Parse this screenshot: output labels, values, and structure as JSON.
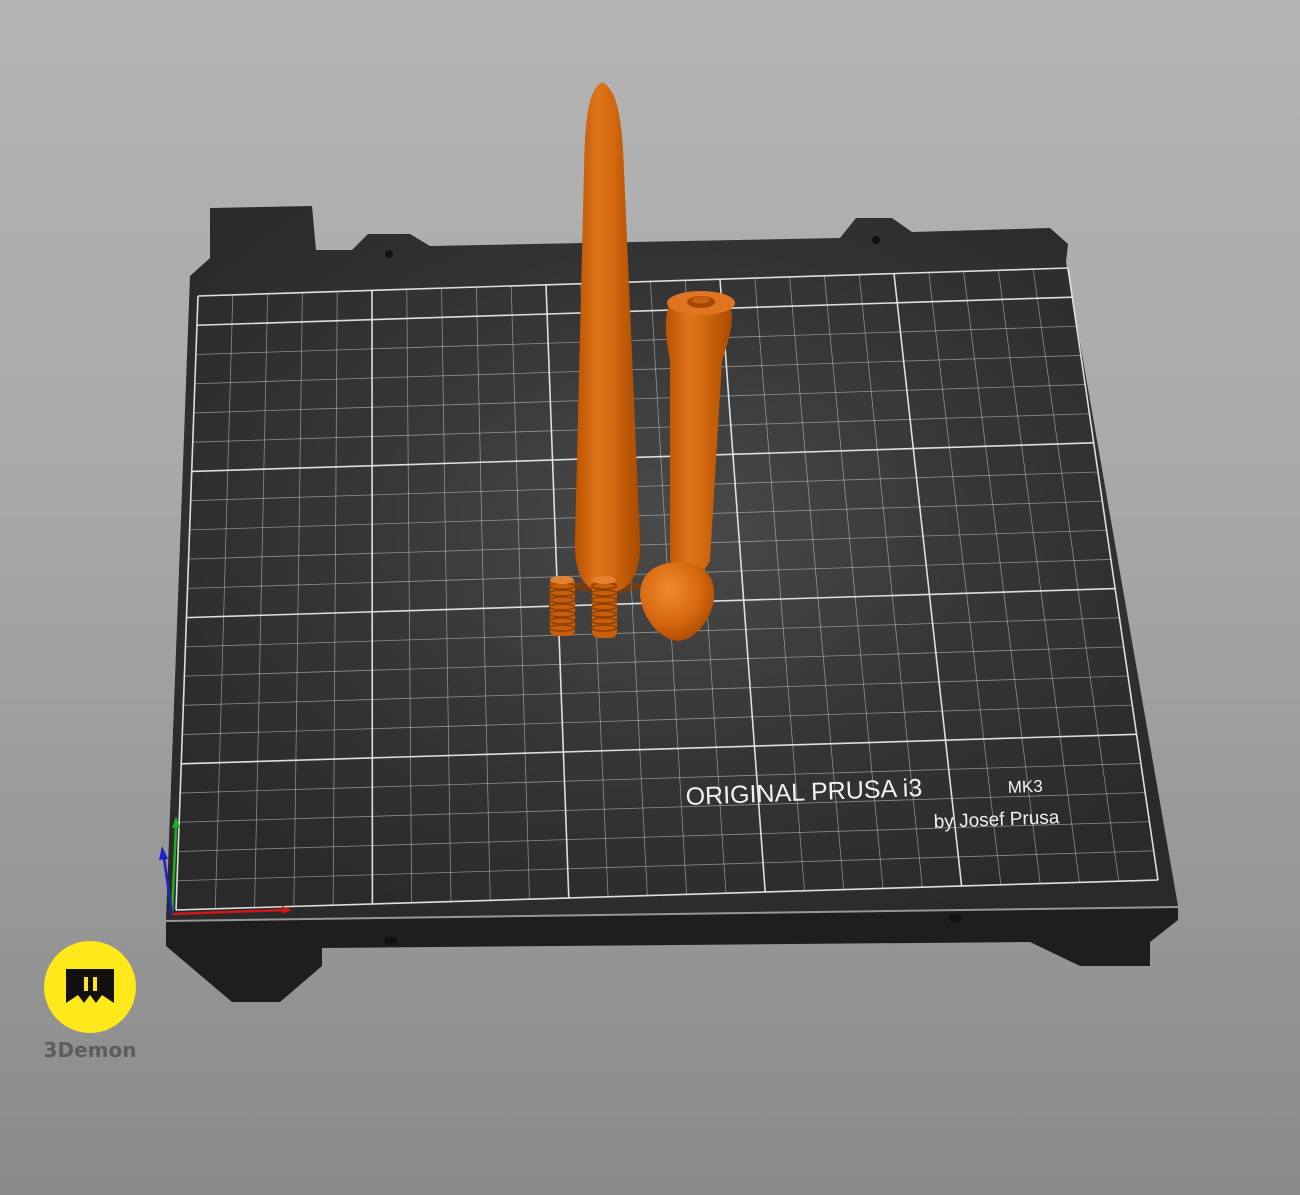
{
  "scene": {
    "background_top": "#b4b4b4",
    "background_bottom": "#8a8a8a",
    "bed_color": "#2f2f2f",
    "grid_color": "#e8e8e8",
    "model_color": "#d9680f"
  },
  "bed": {
    "brand_line1": "ORIGINAL PRUSA i3",
    "brand_model": "MK3",
    "brand_line2": "by Josef Prusa"
  },
  "axes": {
    "x_color": "#d01818",
    "y_color": "#1fb01f",
    "z_color": "#2020c8"
  },
  "models": [
    {
      "name": "tall tapered rod"
    },
    {
      "name": "hollow tube with threaded end"
    },
    {
      "name": "dome cap"
    },
    {
      "name": "threaded plug 1"
    },
    {
      "name": "threaded plug 2"
    }
  ],
  "watermark": {
    "label": "3Demon",
    "badge_color": "#ffe91a",
    "icon": "3demon-logo-icon"
  }
}
